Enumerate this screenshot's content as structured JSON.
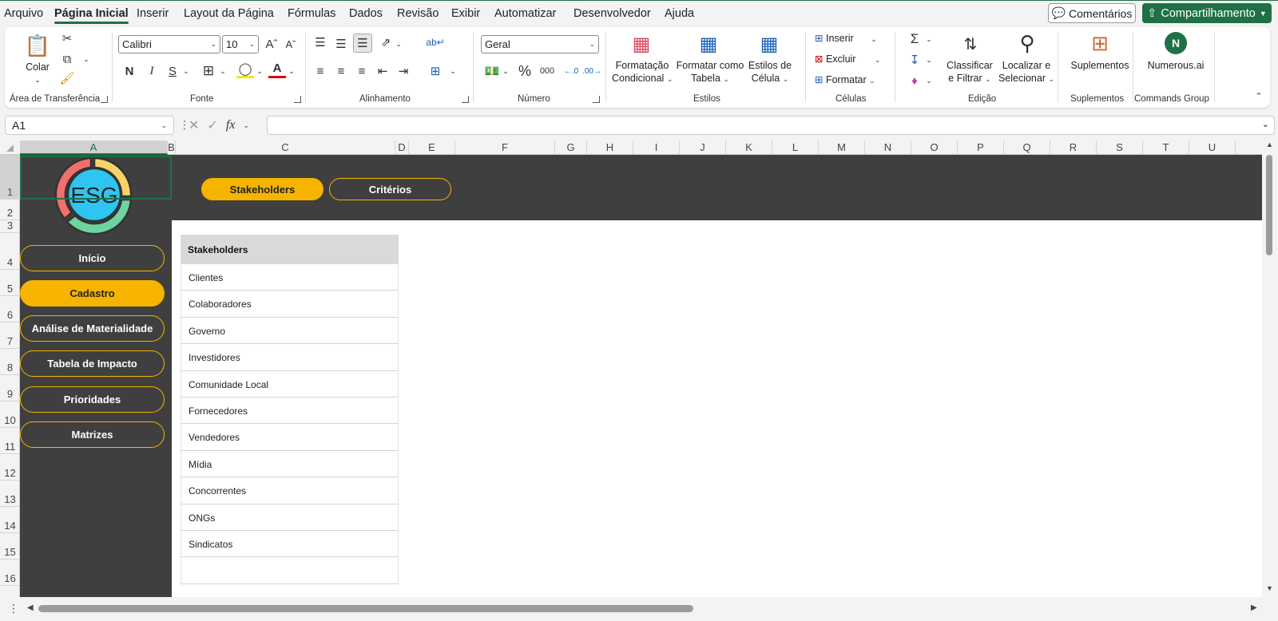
{
  "menu": {
    "items": [
      "Arquivo",
      "Página Inicial",
      "Inserir",
      "Layout da Página",
      "Fórmulas",
      "Dados",
      "Revisão",
      "Exibir",
      "Automatizar",
      "Desenvolvedor",
      "Ajuda"
    ],
    "active": "Página Inicial",
    "comments_label": "Comentários",
    "share_label": "Compartilhamento"
  },
  "ribbon": {
    "clipboard": {
      "paste_label": "Colar",
      "group_label": "Área de Transferência"
    },
    "font": {
      "font_name": "Calibri",
      "font_size": "10",
      "group_label": "Fonte",
      "bold": "N",
      "italic": "I",
      "underline": "S"
    },
    "alignment": {
      "group_label": "Alinhamento"
    },
    "number": {
      "format": "Geral",
      "group_label": "Número",
      "percent": "%",
      "thousands": "000"
    },
    "styles": {
      "conditional_l1": "Formatação",
      "conditional_l2": "Condicional",
      "table_l1": "Formatar como",
      "table_l2": "Tabela",
      "cell_l1": "Estilos de",
      "cell_l2": "Célula",
      "group_label": "Estilos"
    },
    "cells": {
      "insert": "Inserir",
      "delete": "Excluir",
      "format": "Formatar",
      "group_label": "Células"
    },
    "editing": {
      "sort_l1": "Classificar",
      "sort_l2": "e Filtrar",
      "find_l1": "Localizar e",
      "find_l2": "Selecionar",
      "group_label": "Edição"
    },
    "addins": {
      "label": "Suplementos",
      "group_label": "Suplementos"
    },
    "commands": {
      "label": "Numerous.ai",
      "group_label": "Commands Group"
    }
  },
  "formula_bar": {
    "name_box": "A1",
    "fx": "fx"
  },
  "columns": [
    {
      "label": "A",
      "w": 185
    },
    {
      "label": "B",
      "w": 10
    },
    {
      "label": "C",
      "w": 275
    },
    {
      "label": "D",
      "w": 17
    },
    {
      "label": "E",
      "w": 58
    },
    {
      "label": "F",
      "w": 125
    },
    {
      "label": "G",
      "w": 40
    },
    {
      "label": "H",
      "w": 58
    },
    {
      "label": "I",
      "w": 58
    },
    {
      "label": "J",
      "w": 58
    },
    {
      "label": "K",
      "w": 58
    },
    {
      "label": "L",
      "w": 58
    },
    {
      "label": "M",
      "w": 58
    },
    {
      "label": "N",
      "w": 58
    },
    {
      "label": "O",
      "w": 58
    },
    {
      "label": "P",
      "w": 58
    },
    {
      "label": "Q",
      "w": 58
    },
    {
      "label": "R",
      "w": 58
    },
    {
      "label": "S",
      "w": 58
    },
    {
      "label": "T",
      "w": 58
    },
    {
      "label": "U",
      "w": 58
    }
  ],
  "rows": [
    "1",
    "2",
    "3",
    "4",
    "5",
    "6",
    "7",
    "8",
    "9",
    "10",
    "11",
    "12",
    "13",
    "14",
    "15",
    "16"
  ],
  "dashboard": {
    "logo_text": "ESG",
    "nav": [
      "Início",
      "Cadastro",
      "Análise de Materialidade",
      "Tabela de Impacto",
      "Prioridades",
      "Matrizes"
    ],
    "nav_active": "Cadastro",
    "tabs": [
      "Stakeholders",
      "Critérios"
    ],
    "tab_active": "Stakeholders",
    "colors": {
      "dark": "#3f3f3f",
      "accent": "#f6b400",
      "excel_green": "#1e7145"
    }
  },
  "table": {
    "header": "Stakeholders",
    "rows": [
      "Clientes",
      "Colaboradores",
      "Governo",
      "Investidores",
      "Comunidade Local",
      "Fornecedores",
      "Vendedores",
      "Mídia",
      "Concorrentes",
      "ONGs",
      "Sindicatos",
      ""
    ]
  }
}
